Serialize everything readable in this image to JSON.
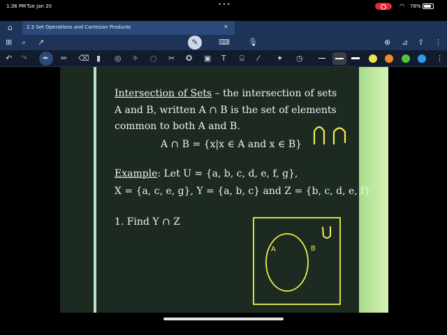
{
  "status": {
    "time": "1:36 PM",
    "date": "Tue Jan 20",
    "battery": "78%"
  },
  "tab": {
    "title": "2.3 Set Operations and Cartesian Products"
  },
  "slide": {
    "heading": "Intersection of Sets",
    "line1_rest": " – the intersection of sets",
    "line2": "A and B, written A ∩ B is the set of elements",
    "line3": "common to both A and B.",
    "formula": "A ∩ B = {x|x ∈ A and x ∈ B}",
    "example_label": "Example",
    "example_line1": ": Let U = {a, b, c, d, e, f, g},",
    "example_line2": "X = {a, c, e, g}, Y = {a, b, c} and Z = {b, c, d, e, f}",
    "question": "1. Find Y ∩ Z"
  },
  "annotations": {
    "handwritten_symbols": "∩ ∩",
    "venn_universe": "U",
    "venn_a": "A",
    "venn_b": "B",
    "ink_color": "#f1f04a"
  },
  "palette": {
    "yellow": "#f3e14d",
    "orange": "#f0892b",
    "green": "#57c43d",
    "blue": "#2e9bf0"
  }
}
